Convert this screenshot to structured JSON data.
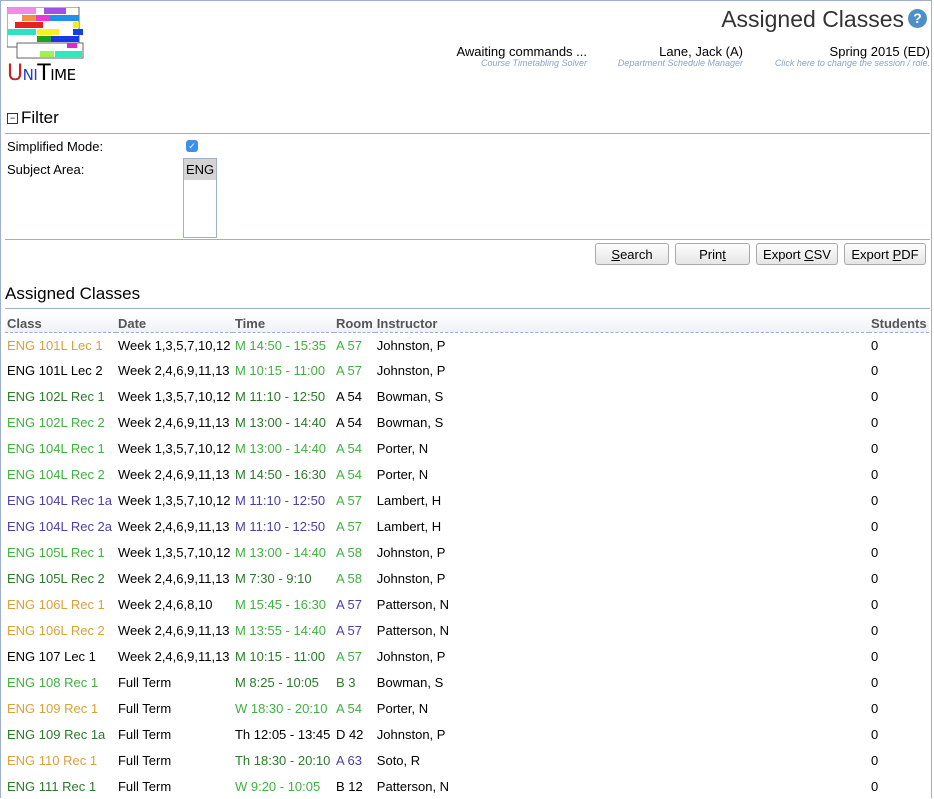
{
  "header": {
    "app_name": "UniTime",
    "page_title": "Assigned Classes",
    "help_icon": "help-icon",
    "status": [
      {
        "main": "Awaiting commands ...",
        "sub": "Course Timetabling Solver"
      },
      {
        "main": "Lane, Jack (A)",
        "sub": "Department Schedule Manager"
      },
      {
        "main": "Spring 2015 (ED)",
        "sub": "Click here to change the session / role."
      }
    ]
  },
  "filter": {
    "title": "Filter",
    "toggle_icon": "collapse-icon",
    "simplified_mode_label": "Simplified Mode:",
    "simplified_mode_checked": true,
    "subject_area_label": "Subject Area:",
    "subject_area_options": [
      "ENG"
    ],
    "subject_area_selected": "ENG"
  },
  "buttons": {
    "search": {
      "pre": "",
      "key": "S",
      "post": "earch"
    },
    "print": {
      "pre": "Prin",
      "key": "t",
      "post": ""
    },
    "export_csv": {
      "pre": "Export ",
      "key": "C",
      "post": "SV"
    },
    "export_pdf": {
      "pre": "Export ",
      "key": "P",
      "post": "DF"
    }
  },
  "results": {
    "title": "Assigned Classes",
    "columns": [
      "Class",
      "Date",
      "Time",
      "Room",
      "Instructor",
      "Students"
    ],
    "colors": {
      "orange": "#D9A13C",
      "light_green": "#3FB13F",
      "dark_green": "#2A7A2A",
      "purple": "#4A3FA8",
      "black": "#000000"
    },
    "rows": [
      {
        "class": "ENG 101L Lec 1",
        "date": "Week 1,3,5,7,10,12",
        "time": "M 14:50 - 15:35",
        "room": "A 57",
        "instructor": "Johnston, P",
        "students": "0",
        "class_color": "orange",
        "time_color": "light_green",
        "room_color": "light_green"
      },
      {
        "class": "ENG 101L Lec 2",
        "date": "Week 2,4,6,9,11,13",
        "time": "M 10:15 - 11:00",
        "room": "A 57",
        "instructor": "Johnston, P",
        "students": "0",
        "class_color": "black",
        "time_color": "light_green",
        "room_color": "light_green"
      },
      {
        "class": "ENG 102L Rec 1",
        "date": "Week 1,3,5,7,10,12",
        "time": "M 11:10 - 12:50",
        "room": "A 54",
        "instructor": "Bowman, S",
        "students": "0",
        "class_color": "dark_green",
        "time_color": "dark_green",
        "room_color": "black"
      },
      {
        "class": "ENG 102L Rec 2",
        "date": "Week 2,4,6,9,11,13",
        "time": "M 13:00 - 14:40",
        "room": "A 54",
        "instructor": "Bowman, S",
        "students": "0",
        "class_color": "light_green",
        "time_color": "dark_green",
        "room_color": "black"
      },
      {
        "class": "ENG 104L Rec 1",
        "date": "Week 1,3,5,7,10,12",
        "time": "M 13:00 - 14:40",
        "room": "A 54",
        "instructor": "Porter, N",
        "students": "0",
        "class_color": "light_green",
        "time_color": "light_green",
        "room_color": "light_green"
      },
      {
        "class": "ENG 104L Rec 2",
        "date": "Week 2,4,6,9,11,13",
        "time": "M 14:50 - 16:30",
        "room": "A 54",
        "instructor": "Porter, N",
        "students": "0",
        "class_color": "light_green",
        "time_color": "dark_green",
        "room_color": "light_green"
      },
      {
        "class": "ENG 104L Rec 1a",
        "date": "Week 1,3,5,7,10,12",
        "time": "M 11:10 - 12:50",
        "room": "A 57",
        "instructor": "Lambert, H",
        "students": "0",
        "class_color": "purple",
        "time_color": "purple",
        "room_color": "light_green"
      },
      {
        "class": "ENG 104L Rec 2a",
        "date": "Week 2,4,6,9,11,13",
        "time": "M 11:10 - 12:50",
        "room": "A 57",
        "instructor": "Lambert, H",
        "students": "0",
        "class_color": "purple",
        "time_color": "purple",
        "room_color": "light_green"
      },
      {
        "class": "ENG 105L Rec 1",
        "date": "Week 1,3,5,7,10,12",
        "time": "M 13:00 - 14:40",
        "room": "A 58",
        "instructor": "Johnston, P",
        "students": "0",
        "class_color": "light_green",
        "time_color": "light_green",
        "room_color": "light_green"
      },
      {
        "class": "ENG 105L Rec 2",
        "date": "Week 2,4,6,9,11,13",
        "time": "M 7:30 - 9:10",
        "room": "A 58",
        "instructor": "Johnston, P",
        "students": "0",
        "class_color": "dark_green",
        "time_color": "dark_green",
        "room_color": "light_green"
      },
      {
        "class": "ENG 106L Rec 1",
        "date": "Week 2,4,6,8,10",
        "time": "M 15:45 - 16:30",
        "room": "A 57",
        "instructor": "Patterson, N",
        "students": "0",
        "class_color": "orange",
        "time_color": "light_green",
        "room_color": "purple"
      },
      {
        "class": "ENG 106L Rec 2",
        "date": "Week 2,4,6,9,11,13",
        "time": "M 13:55 - 14:40",
        "room": "A 57",
        "instructor": "Patterson, N",
        "students": "0",
        "class_color": "orange",
        "time_color": "light_green",
        "room_color": "purple"
      },
      {
        "class": "ENG 107 Lec 1",
        "date": "Week 2,4,6,9,11,13",
        "time": "M 10:15 - 11:00",
        "room": "A 57",
        "instructor": "Johnston, P",
        "students": "0",
        "class_color": "black",
        "time_color": "dark_green",
        "room_color": "light_green"
      },
      {
        "class": "ENG 108 Rec 1",
        "date": "Full Term",
        "time": "M 8:25 - 10:05",
        "room": "B 3",
        "instructor": "Bowman, S",
        "students": "0",
        "class_color": "light_green",
        "time_color": "dark_green",
        "room_color": "dark_green"
      },
      {
        "class": "ENG 109 Rec 1",
        "date": "Full Term",
        "time": "W 18:30 - 20:10",
        "room": "A 54",
        "instructor": "Porter, N",
        "students": "0",
        "class_color": "orange",
        "time_color": "light_green",
        "room_color": "light_green"
      },
      {
        "class": "ENG 109 Rec 1a",
        "date": "Full Term",
        "time": "Th 12:05 - 13:45",
        "room": "D 42",
        "instructor": "Johnston, P",
        "students": "0",
        "class_color": "dark_green",
        "time_color": "black",
        "room_color": "black"
      },
      {
        "class": "ENG 110 Rec 1",
        "date": "Full Term",
        "time": "Th 18:30 - 20:10",
        "room": "A 63",
        "instructor": "Soto, R",
        "students": "0",
        "class_color": "orange",
        "time_color": "dark_green",
        "room_color": "purple"
      },
      {
        "class": "ENG 111 Rec 1",
        "date": "Full Term",
        "time": "W 9:20 - 10:05",
        "room": "B 12",
        "instructor": "Patterson, N",
        "students": "0",
        "class_color": "dark_green",
        "time_color": "light_green",
        "room_color": "black"
      }
    ]
  }
}
